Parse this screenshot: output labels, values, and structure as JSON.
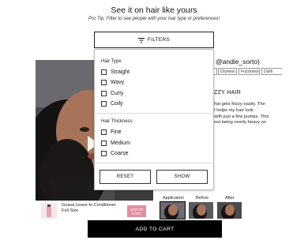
{
  "header": {
    "title": "See it on hair like yours",
    "tip": "Pro Tip: Filter to see people with your hair type or preferences!"
  },
  "filters_button": {
    "label": "FILTERS"
  },
  "filter_panel": {
    "hair_type": {
      "title": "Hair Type",
      "options": [
        "Straight",
        "Wavy",
        "Curly",
        "Coily"
      ]
    },
    "hair_thickness": {
      "title": "Hair Thickness",
      "options": [
        "Fine",
        "Medium",
        "Coarse"
      ]
    },
    "reset_label": "RESET",
    "show_label": "SHOW"
  },
  "review": {
    "handle": "@andie_sorto)",
    "chips": [
      "Dryness",
      "Frizziness",
      "Dulln"
    ],
    "heading": "ZZY HAIR",
    "lines": [
      "hat gets frizzy easily. The",
      "t helps my hair look",
      "with just a few pumps. This",
      "out being overly heavy on"
    ]
  },
  "product": {
    "name": "Guava Leave-In Conditioner",
    "size": "Full Size",
    "add_label": "ADD TO CART"
  },
  "thumbnails": {
    "labels": [
      "Application",
      "Before",
      "After"
    ]
  },
  "cart": {
    "label": "ADD TO CART"
  }
}
